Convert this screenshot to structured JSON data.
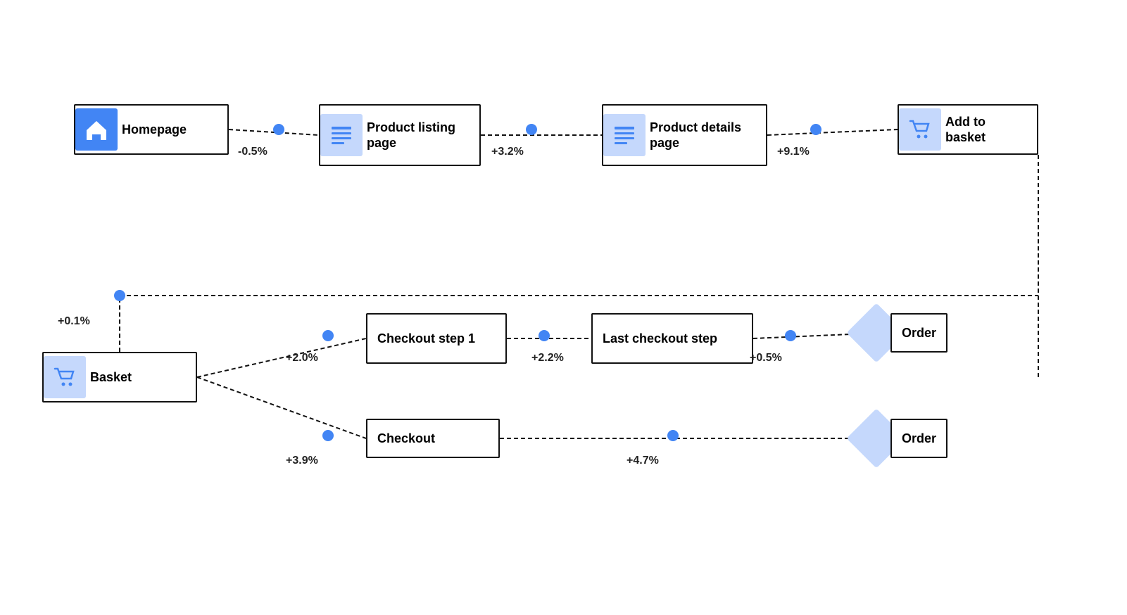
{
  "nodes": {
    "homepage": {
      "label": "Homepage"
    },
    "product_listing": {
      "label": "Product listing page"
    },
    "product_details": {
      "label": "Product details page"
    },
    "add_to_basket": {
      "label": "Add to basket"
    },
    "basket": {
      "label": "Basket"
    },
    "checkout_step1": {
      "label": "Checkout step 1"
    },
    "last_checkout": {
      "label": "Last checkout step"
    },
    "order_top": {
      "label": "Order"
    },
    "checkout": {
      "label": "Checkout"
    },
    "order_bottom": {
      "label": "Order"
    }
  },
  "percentages": {
    "homepage_to_listing": "-0.5%",
    "listing_to_details": "+3.2%",
    "details_to_basket": "+9.1%",
    "basket_return": "+0.1%",
    "basket_to_checkout1": "+2.0%",
    "checkout1_to_last": "+2.2%",
    "last_to_order": "+0.5%",
    "basket_to_checkout": "+3.9%",
    "checkout_to_order": "+4.7%"
  },
  "colors": {
    "blue": "#4285f4",
    "light_blue": "#c5d8fc",
    "black": "#111111",
    "text": "#222222"
  }
}
